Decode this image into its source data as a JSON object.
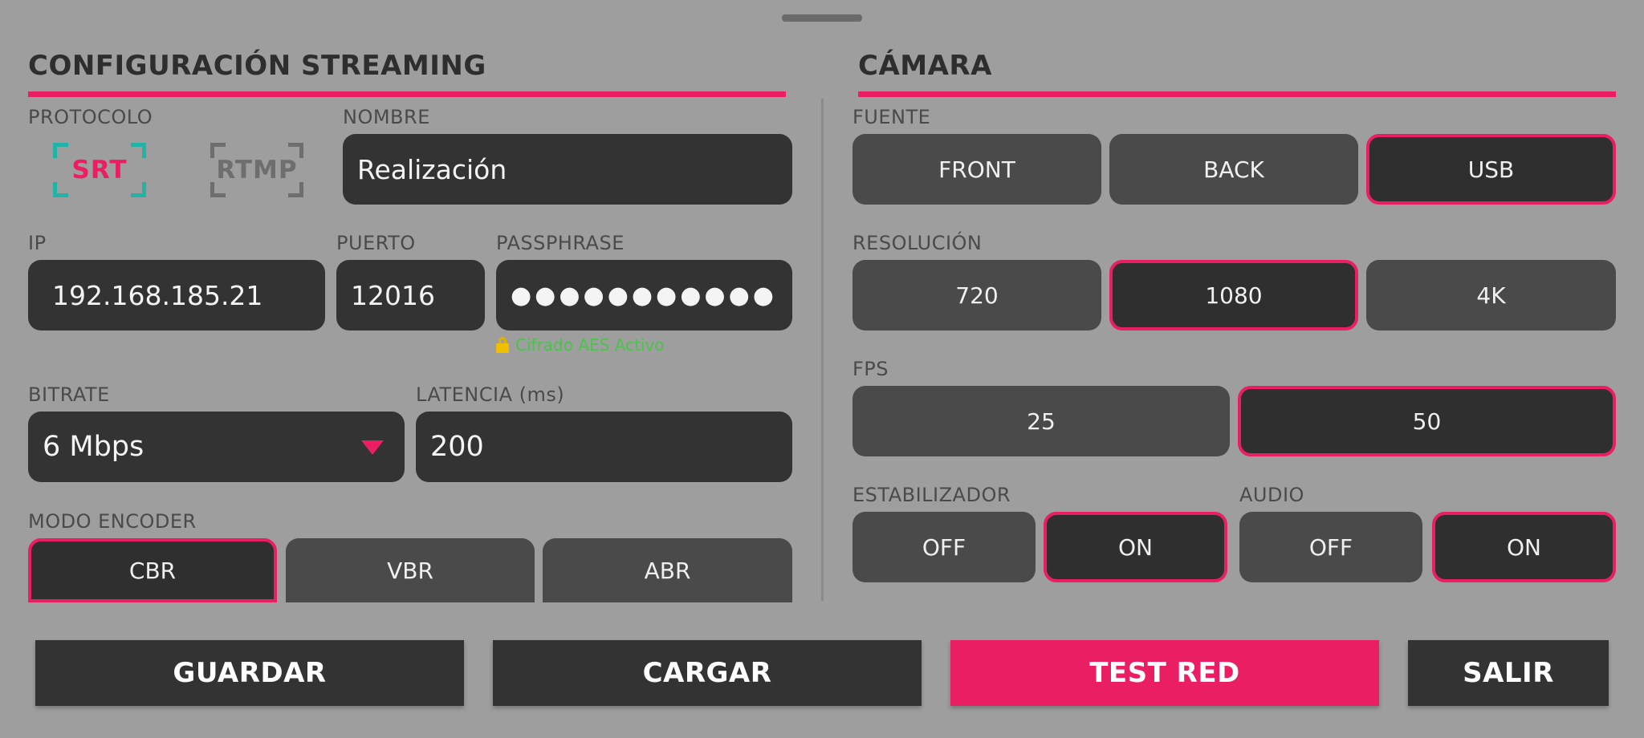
{
  "streaming": {
    "title": "CONFIGURACIÓN STREAMING",
    "protocol_label": "PROTOCOLO",
    "protocols": [
      {
        "label": "SRT",
        "selected": true
      },
      {
        "label": "RTMP",
        "selected": false
      }
    ],
    "name_label": "NOMBRE",
    "name_value": "Realización",
    "ip_label": "IP",
    "ip_value": "192.168.185.21",
    "port_label": "PUERTO",
    "port_value": "12016",
    "passphrase_label": "PASSPHRASE",
    "passphrase_value": "●●●●●●●●●●●",
    "aes_status": "Cifrado AES Activo",
    "bitrate_label": "BITRATE",
    "bitrate_value": "6 Mbps",
    "latency_label": "LATENCIA (ms)",
    "latency_value": "200",
    "encoder_label": "MODO ENCODER",
    "encoder_options": [
      "CBR",
      "VBR",
      "ABR"
    ],
    "encoder_selected": "CBR"
  },
  "camera": {
    "title": "CÁMARA",
    "source_label": "FUENTE",
    "source_options": [
      "FRONT",
      "BACK",
      "USB"
    ],
    "source_selected": "USB",
    "resolution_label": "RESOLUCIÓN",
    "resolution_options": [
      "720",
      "1080",
      "4K"
    ],
    "resolution_selected": "1080",
    "fps_label": "FPS",
    "fps_options": [
      "25",
      "50"
    ],
    "fps_selected": "50",
    "stabilizer_label": "ESTABILIZADOR",
    "stabilizer_options": [
      "OFF",
      "ON"
    ],
    "stabilizer_selected": "ON",
    "audio_label": "AUDIO",
    "audio_options": [
      "OFF",
      "ON"
    ],
    "audio_selected": "ON"
  },
  "actions": {
    "save": "GUARDAR",
    "load": "CARGAR",
    "test": "TEST RED",
    "exit": "SALIR"
  },
  "colors": {
    "accent": "#ea1e63",
    "srt_bracket": "#21b3a5",
    "aes_ok": "#4cc24c",
    "background": "#9e9e9e"
  }
}
